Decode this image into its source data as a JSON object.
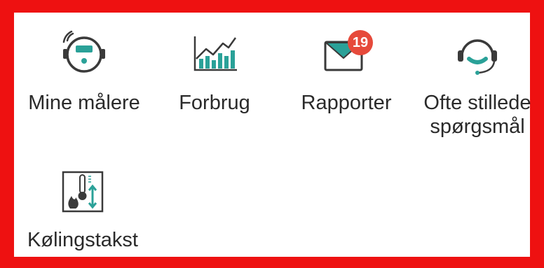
{
  "tiles": [
    {
      "id": "meters",
      "label": "Mine målere",
      "icon": "meter-icon"
    },
    {
      "id": "usage",
      "label": "Forbrug",
      "icon": "bar-chart-icon"
    },
    {
      "id": "reports",
      "label": "Rapporter",
      "icon": "mail-icon",
      "badge": "19"
    },
    {
      "id": "faq",
      "label": "Ofte stillede\nspørgsmål",
      "icon": "headset-icon"
    },
    {
      "id": "cooling",
      "label": "Kølingstakst",
      "icon": "thermometer-icon"
    }
  ],
  "colors": {
    "frame": "#ee1111",
    "accent": "#2aa198",
    "badge": "#e64a3b",
    "icon_outline": "#3a3a3a"
  }
}
